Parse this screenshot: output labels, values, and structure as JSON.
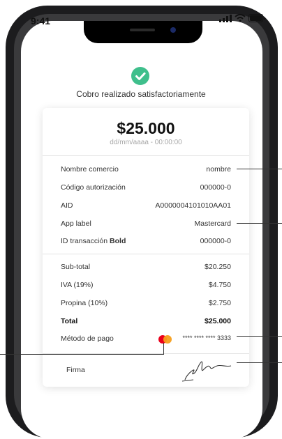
{
  "status_bar": {
    "time": "9:41"
  },
  "header": {
    "success_message": "Cobro realizado satisfactoriamente"
  },
  "receipt": {
    "amount": "$25.000",
    "datetime": "dd/mm/aaaa - 00:00:00",
    "details": [
      {
        "label": "Nombre comercio",
        "value": "nombre"
      },
      {
        "label": "Código autorización",
        "value": "000000-0"
      },
      {
        "label": "AID",
        "value": "A0000004101010AA01"
      },
      {
        "label": "App label",
        "value": "Mastercard"
      },
      {
        "label": "ID transacción",
        "label_bold": "Bold",
        "value": "000000-0"
      }
    ],
    "summary": [
      {
        "label": "Sub-total",
        "value": "$20.250"
      },
      {
        "label": "IVA (19%)",
        "value": "$4.750"
      },
      {
        "label": "Propina (10%)",
        "value": "$2.750"
      },
      {
        "label": "Total",
        "value": "$25.000"
      }
    ],
    "payment": {
      "label": "Método de pago",
      "card_number": "**** **** **** 3333",
      "card_brand_icon": "mastercard-logo"
    },
    "signature": {
      "label": "Firma"
    }
  },
  "colors": {
    "success_green": "#3fbf8c",
    "mastercard_red": "#eb001b",
    "mastercard_orange": "#f79e1b"
  }
}
